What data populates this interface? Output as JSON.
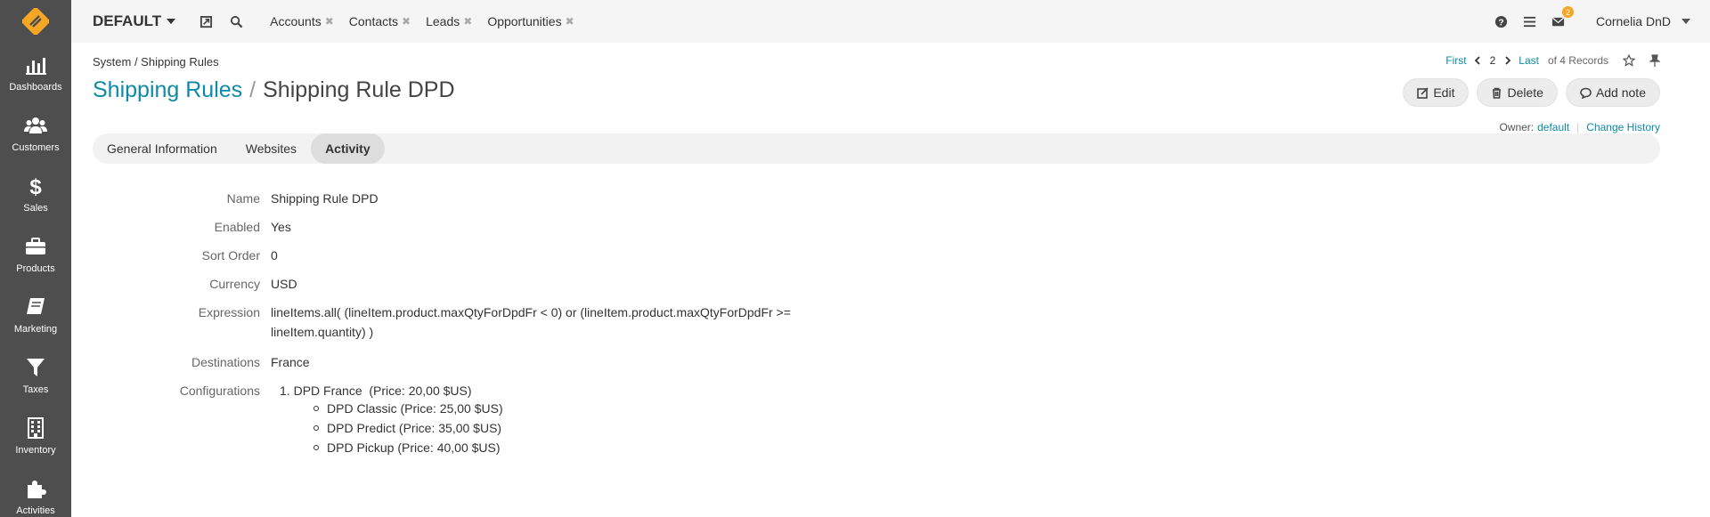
{
  "sidebar": {
    "items": [
      {
        "label": "Dashboards",
        "icon": "dashboards-icon"
      },
      {
        "label": "Customers",
        "icon": "customers-icon"
      },
      {
        "label": "Sales",
        "icon": "dollar-icon"
      },
      {
        "label": "Products",
        "icon": "briefcase-icon"
      },
      {
        "label": "Marketing",
        "icon": "book-icon"
      },
      {
        "label": "Taxes",
        "icon": "filter-icon"
      },
      {
        "label": "Inventory",
        "icon": "building-icon"
      },
      {
        "label": "Activities",
        "icon": "puzzle-icon"
      }
    ]
  },
  "topbar": {
    "org": "DEFAULT",
    "shortcuts": [
      "Accounts",
      "Contacts",
      "Leads",
      "Opportunities"
    ],
    "notification_count": "2",
    "user": "Cornelia DnD"
  },
  "breadcrumb": "System / Shipping Rules",
  "pager": {
    "first": "First",
    "current": "2",
    "last": "Last",
    "total": "of 4 Records"
  },
  "title": {
    "parent": "Shipping Rules",
    "separator": "/",
    "current": "Shipping Rule DPD"
  },
  "actions": {
    "edit": "Edit",
    "delete": "Delete",
    "add_note": "Add note"
  },
  "owner": {
    "label": "Owner:",
    "value": "default",
    "change_history": "Change History"
  },
  "tabs": [
    "General Information",
    "Websites",
    "Activity"
  ],
  "active_tab": "Activity",
  "fields": {
    "name": {
      "label": "Name",
      "value": "Shipping Rule DPD"
    },
    "enabled": {
      "label": "Enabled",
      "value": "Yes"
    },
    "sort_order": {
      "label": "Sort Order",
      "value": "0"
    },
    "currency": {
      "label": "Currency",
      "value": "USD"
    },
    "expression": {
      "label": "Expression",
      "value": "lineItems.all( (lineItem.product.maxQtyForDpdFr < 0) or (lineItem.product.maxQtyForDpdFr >= lineItem.quantity) )"
    },
    "destinations": {
      "label": "Destinations",
      "value": "France"
    },
    "configurations": {
      "label": "Configurations",
      "top_number": "1.",
      "top_item": "DPD France  (Price: 20,00 $US)",
      "sub_items": [
        "DPD Classic (Price: 25,00 $US)",
        "DPD Predict (Price: 35,00 $US)",
        "DPD Pickup (Price: 40,00 $US)"
      ]
    }
  },
  "colors": {
    "sidebar": "#4e4e4e",
    "link": "#0c8aa8",
    "logo": "#f5a623",
    "tabs_bg": "#f2f2f2",
    "active_tab": "#dddddd"
  }
}
